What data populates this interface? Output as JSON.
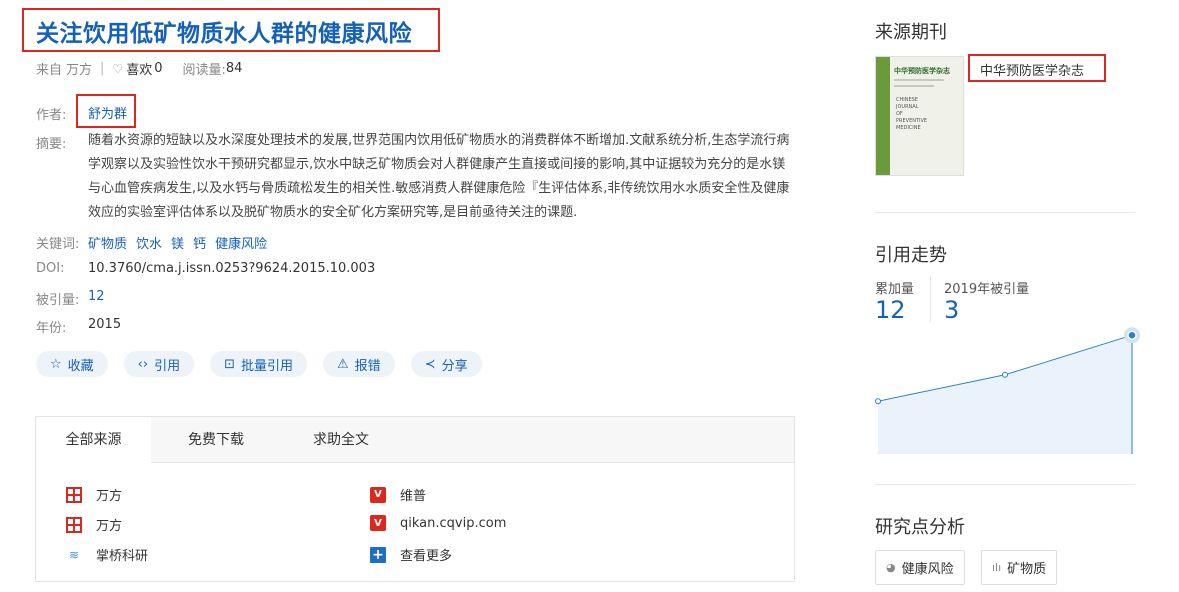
{
  "article": {
    "title": "关注饮用低矿物质水人群的健康风险",
    "source_prefix": "来自",
    "source": "万方",
    "like_label": "喜欢",
    "like_count": "0",
    "read_label": "阅读量:",
    "read_count": "84"
  },
  "fields": {
    "author_label": "作者:",
    "author": "舒为群",
    "abstract_label": "摘要:",
    "abstract_lines": [
      "随着水资源的短缺以及水深度处理技术的发展,世界范围内饮用低矿物质水的消费群体不断增加.文献系统分析,生态学流行病",
      "学观察以及实验性饮水干预研究都显示,饮水中缺乏矿物质会对人群健康产生直接或间接的影响,其中证据较为充分的是水镁",
      "与心血管疾病发生,以及水钙与骨质疏松发生的相关性.敏感消费人群健康危险『生评估体系,非传统饮用水水质安全性及健康",
      "效应的实验室评估体系以及脱矿物质水的安全矿化方案研究等,是目前亟待关注的课题."
    ],
    "keywords_label": "关键词:",
    "keywords": [
      "矿物质",
      "饮水",
      "镁",
      "钙",
      "健康风险"
    ],
    "doi_label": "DOI:",
    "doi": "10.3760/cma.j.issn.0253?9624.2015.10.003",
    "cited_label": "被引量:",
    "cited": "12",
    "year_label": "年份:",
    "year": "2015"
  },
  "actions": [
    {
      "label": "收藏",
      "icon": "star-icon",
      "glyph": "☆"
    },
    {
      "label": "引用",
      "icon": "code-icon",
      "glyph": "‹›"
    },
    {
      "label": "批量引用",
      "icon": "batch-cite-icon",
      "glyph": "⊡"
    },
    {
      "label": "报错",
      "icon": "warning-icon",
      "glyph": "⚠"
    },
    {
      "label": "分享",
      "icon": "share-icon",
      "glyph": "≺"
    }
  ],
  "sources": {
    "tabs": [
      "全部来源",
      "免费下载",
      "求助全文"
    ],
    "items": [
      {
        "label": "万方",
        "icon": "wanfang-icon"
      },
      {
        "label": "维普",
        "icon": "vip-icon"
      },
      {
        "label": "万方",
        "icon": "wanfang-icon"
      },
      {
        "label": "qikan.cqvip.com",
        "icon": "vip-icon"
      },
      {
        "label": "掌桥科研",
        "icon": "zhangqiao-icon"
      },
      {
        "label": "查看更多",
        "icon": "plus-icon"
      }
    ]
  },
  "journal": {
    "heading": "来源期刊",
    "name": "中华预防医学杂志",
    "cover_title": "中华预防医学杂志",
    "cover_english": [
      "CHINESE",
      "JOURNAL",
      "OF",
      "PREVENTIVE",
      "MEDICINE"
    ]
  },
  "citation": {
    "heading": "引用走势",
    "total_label": "累加量",
    "total_value": "12",
    "year_label": "2019年被引量",
    "year_value": "3"
  },
  "chart_data": {
    "type": "area",
    "values": [
      4,
      6,
      9
    ],
    "ylim": [
      0,
      10
    ],
    "fill_color": "#eaf3fb",
    "line_color": "#2b7fd1",
    "highlight_last": true
  },
  "research": {
    "heading": "研究点分析",
    "tags": [
      {
        "label": "健康风险",
        "icon": "pie-icon",
        "glyph": "◕"
      },
      {
        "label": "矿物质",
        "icon": "bar-chart-icon",
        "glyph": "ılı"
      }
    ]
  },
  "colors": {
    "link_blue": "#1561b6",
    "highlight_red": "#d9281e"
  }
}
